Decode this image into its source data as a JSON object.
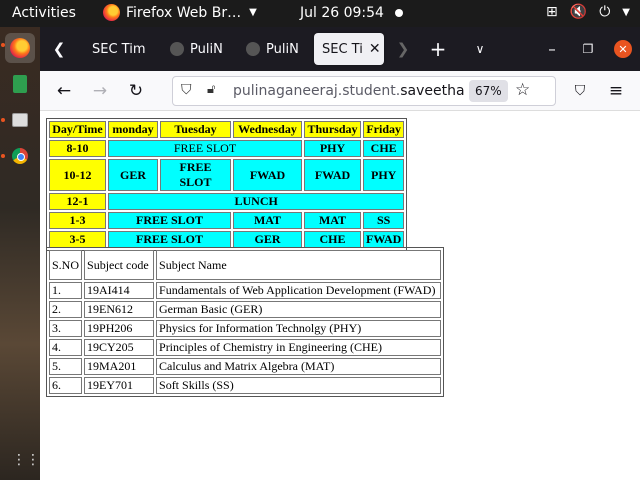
{
  "topbar": {
    "activities": "Activities",
    "app_name": "Firefox Web Br…",
    "clock": "Jul 26  09:54"
  },
  "icons": {
    "network": "network-icon",
    "volume": "volume-muted-icon",
    "power": "power-icon",
    "apps": "apps-grid-icon"
  },
  "tabs": [
    {
      "label": "SEC Tim"
    },
    {
      "label": "PuliN"
    },
    {
      "label": "PuliN"
    },
    {
      "label": "SEC Ti"
    }
  ],
  "navbar": {
    "url_prefix": "pulinaganeeraj.student.",
    "url_domain": "saveetha",
    "zoom": "67%"
  },
  "timetable": {
    "header": [
      "Day/Time",
      "monday",
      "Tuesday",
      "Wednesday",
      "Thursday",
      "Friday"
    ],
    "rows": [
      {
        "time": "8-10",
        "free": "FREE SLOT",
        "thu": "PHY",
        "fri": "CHE"
      },
      {
        "time": "10-12",
        "mon": "GER",
        "tue": "FREE SLOT",
        "wed": "FWAD",
        "thu": "FWAD",
        "fri": "PHY"
      },
      {
        "time": "12-1",
        "lunch": "LUNCH"
      },
      {
        "time": "1-3",
        "free": "FREE SLOT",
        "wed": "MAT",
        "thu": "MAT",
        "fri": "SS"
      },
      {
        "time": "3-5",
        "free": "FREE SLOT",
        "wed": "GER",
        "thu": "CHE",
        "fri": "FWAD"
      }
    ]
  },
  "subjects": {
    "header": [
      "S.NO",
      "Subject code",
      "Subject Name"
    ],
    "rows": [
      [
        "1.",
        "19AI414",
        "Fundamentals of Web Application Development (FWAD)"
      ],
      [
        "2.",
        "19EN612",
        "German Basic (GER)"
      ],
      [
        "3.",
        "19PH206",
        "Physics for Information Technolgy (PHY)"
      ],
      [
        "4.",
        "19CY205",
        "Principles of Chemistry in Engineering (CHE)"
      ],
      [
        "5.",
        "19MA201",
        "Calculus and Matrix Algebra (MAT)"
      ],
      [
        "6.",
        "19EY701",
        "Soft Skills (SS)"
      ]
    ]
  },
  "colors": {
    "header_cell": "#ffff00",
    "slot_cell": "#00ffff",
    "accent": "#e95420"
  }
}
